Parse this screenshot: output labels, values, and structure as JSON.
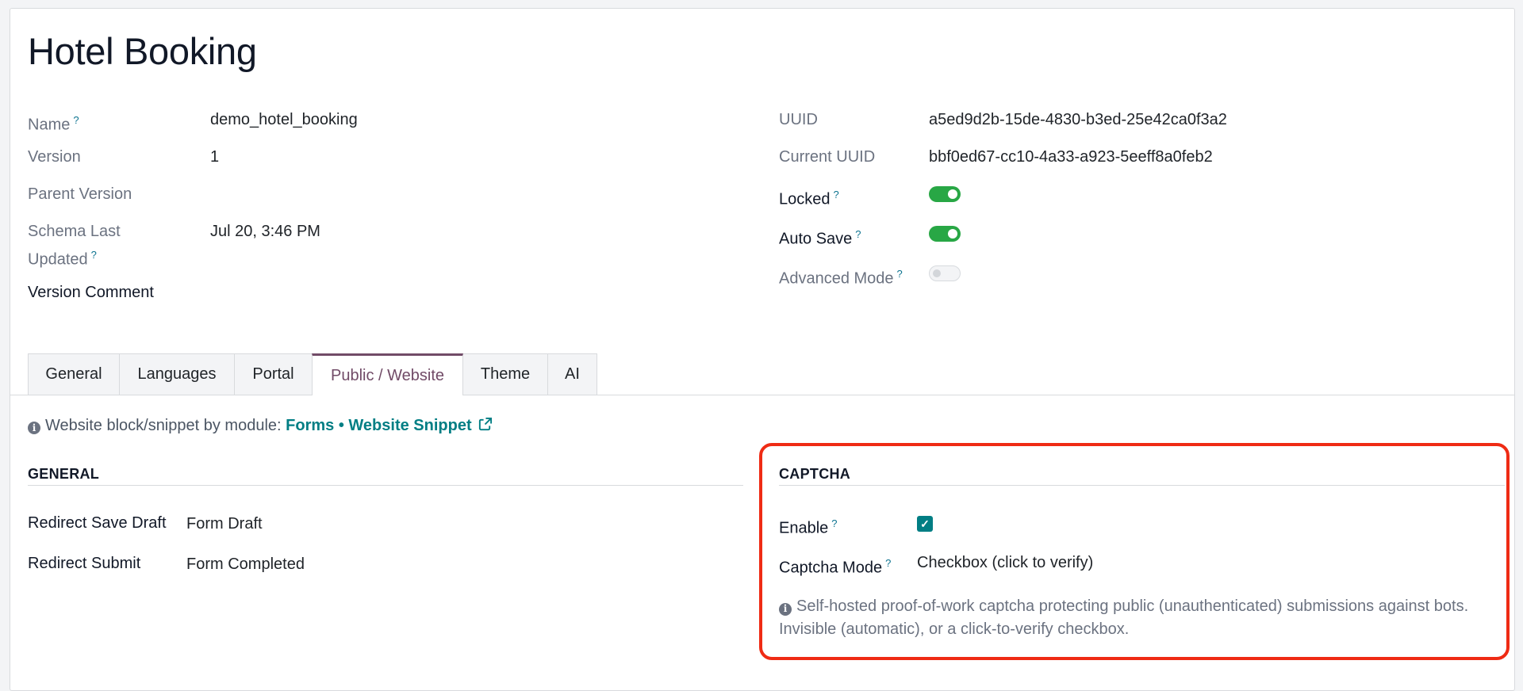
{
  "record": {
    "title": "Hotel Booking"
  },
  "left_fields": {
    "name_label": "Name",
    "name_value": "demo_hotel_booking",
    "version_label": "Version",
    "version_value": "1",
    "parent_version_label": "Parent Version",
    "schema_label_1": "Schema Last",
    "schema_label_2": "Updated",
    "schema_value": "Jul 20, 3:46 PM",
    "version_comment_label": "Version Comment"
  },
  "right_fields": {
    "uuid_label": "UUID",
    "uuid_value": "a5ed9d2b-15de-4830-b3ed-25e42ca0f3a2",
    "current_uuid_label": "Current UUID",
    "current_uuid_value": "bbf0ed67-cc10-4a33-a923-5eeff8a0feb2",
    "locked_label": "Locked",
    "locked_on": true,
    "auto_save_label": "Auto Save",
    "auto_save_on": true,
    "advanced_mode_label": "Advanced Mode",
    "advanced_mode_on": false
  },
  "help_marker": "?",
  "tabs": [
    {
      "label": "General",
      "active": false
    },
    {
      "label": "Languages",
      "active": false
    },
    {
      "label": "Portal",
      "active": false
    },
    {
      "label": "Public / Website",
      "active": true
    },
    {
      "label": "Theme",
      "active": false
    },
    {
      "label": "AI",
      "active": false
    }
  ],
  "module_info": {
    "prefix": "Website block/snippet by module:",
    "module_1": "Forms",
    "separator": "•",
    "module_2": "Website Snippet"
  },
  "general_section": {
    "heading": "GENERAL",
    "redirect_save_draft_label": "Redirect Save Draft",
    "redirect_save_draft_value": "Form Draft",
    "redirect_submit_label": "Redirect Submit",
    "redirect_submit_value": "Form Completed"
  },
  "captcha_section": {
    "heading": "CAPTCHA",
    "enable_label": "Enable",
    "enable_checked": true,
    "mode_label": "Captcha Mode",
    "mode_value": "Checkbox (click to verify)",
    "note": "Self-hosted proof-of-work captcha protecting public (unauthenticated) submissions against bots. Invisible (automatic), or a click-to-verify checkbox."
  },
  "colors": {
    "accent": "#714b67",
    "link": "#017e84",
    "toggle_on": "#28a745",
    "highlight": "#ef2b14"
  }
}
